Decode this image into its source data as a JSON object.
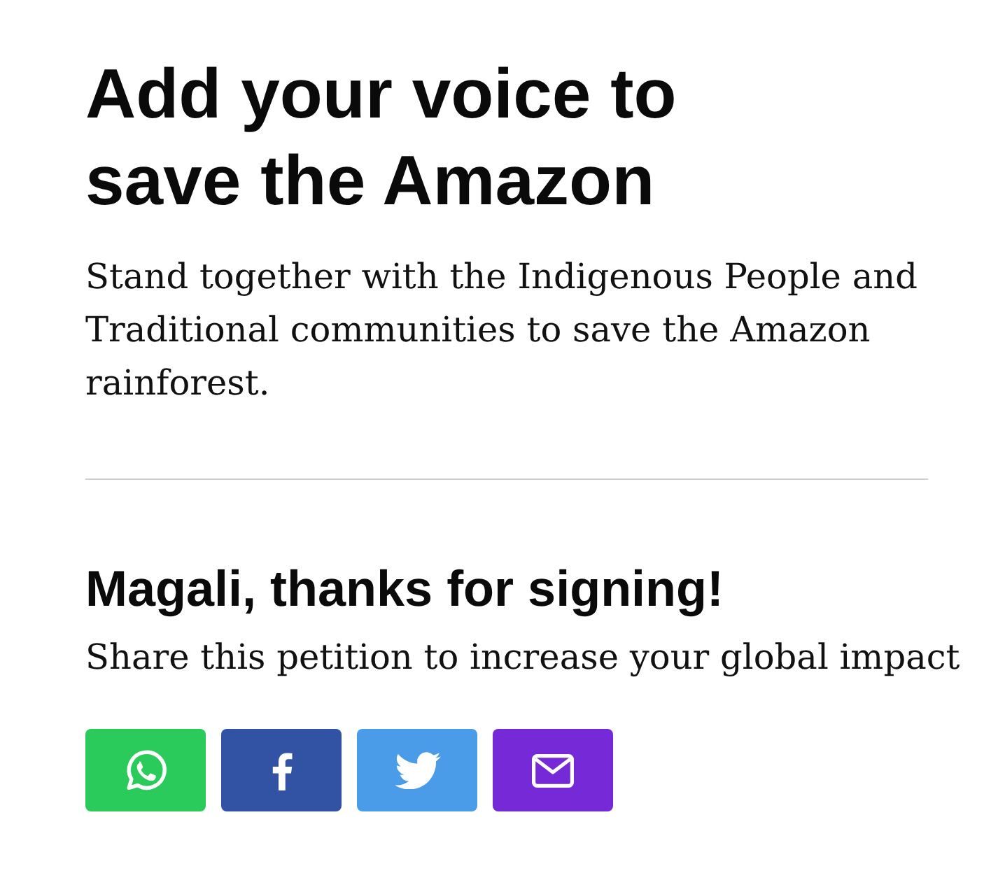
{
  "headline": "Add your voice to save the Amazon",
  "intro": "Stand together with the Indigenous People and Traditional communities to save the Amazon rainforest.",
  "confirmation": {
    "title": "Magali, thanks for signing!",
    "subtitle": "Share this petition to increase your global impact"
  },
  "share_buttons": [
    {
      "kind": "whatsapp",
      "color": "#2acb5a"
    },
    {
      "kind": "facebook",
      "color": "#3253a4"
    },
    {
      "kind": "twitter",
      "color": "#4b9ce8"
    },
    {
      "kind": "email",
      "color": "#7529d7"
    }
  ]
}
